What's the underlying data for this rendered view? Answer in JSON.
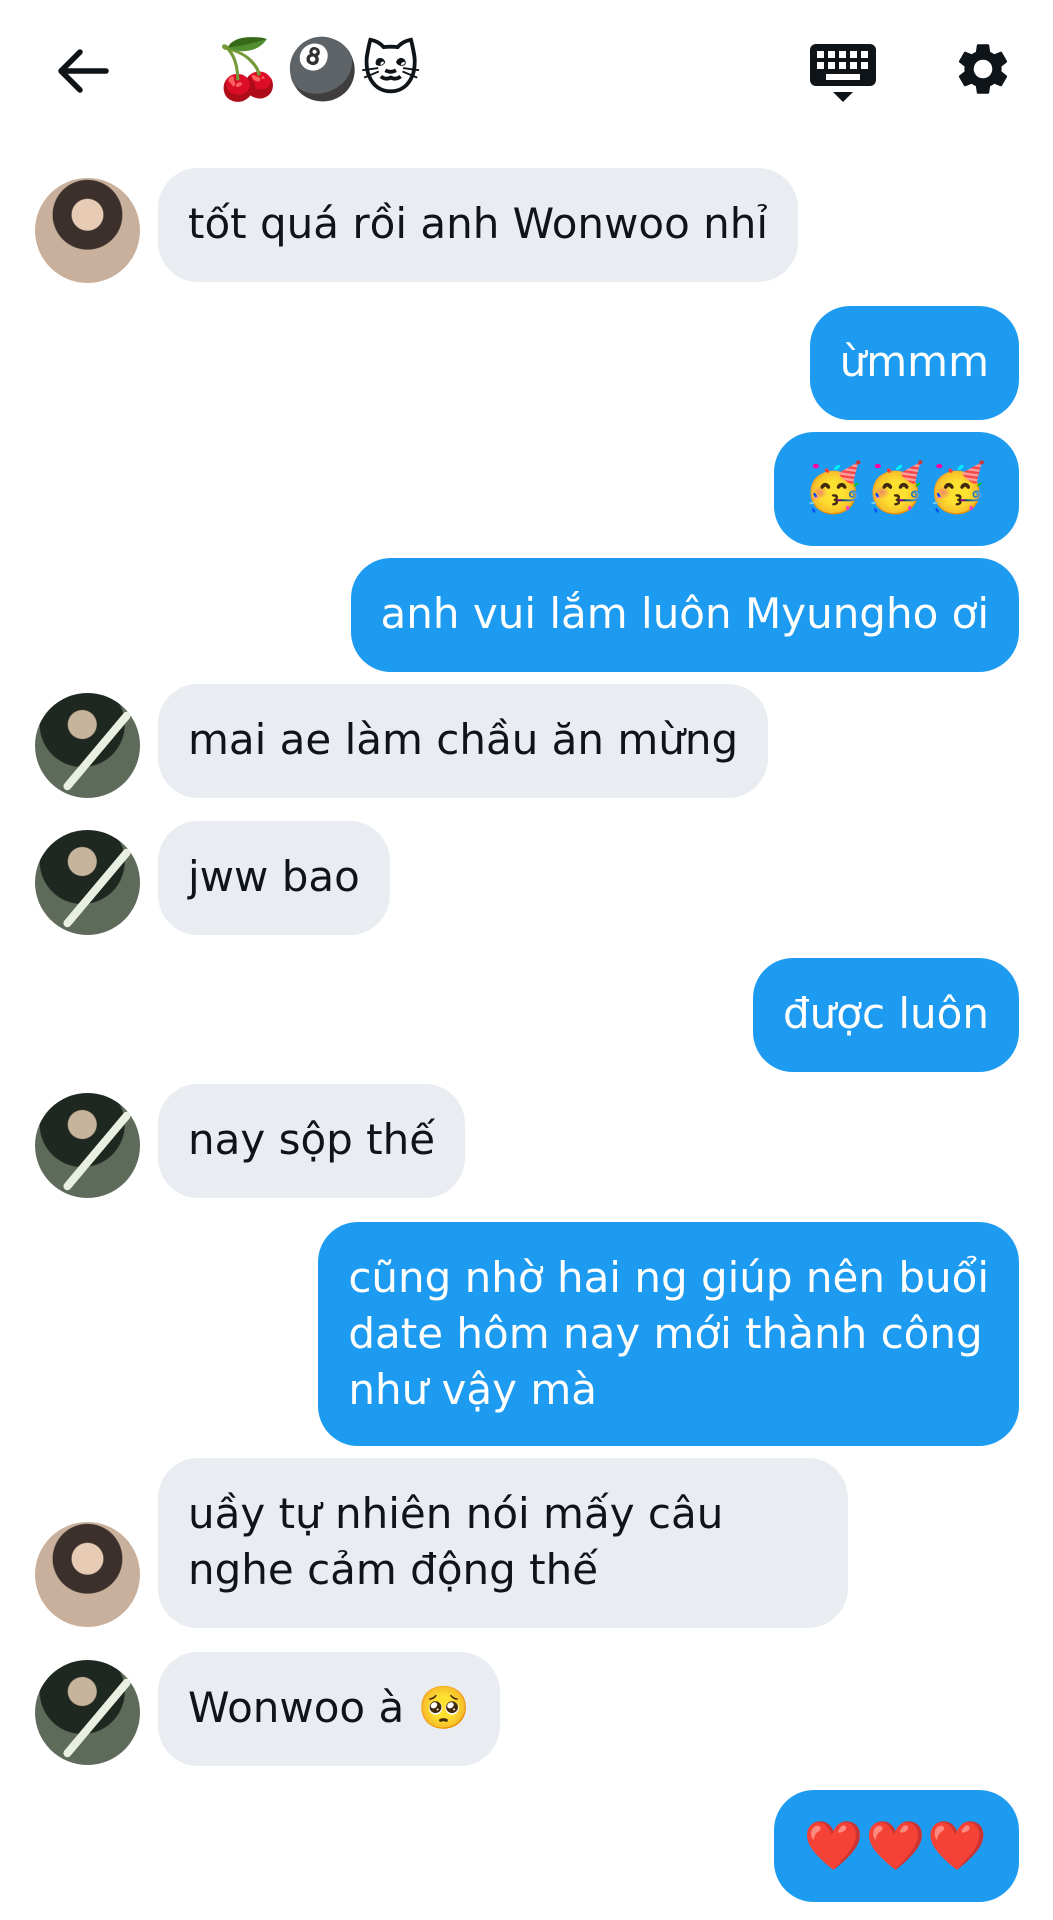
{
  "header": {
    "title": "🍒🎱🐱",
    "back_icon": "arrow-left-icon",
    "keyboard_icon": "keyboard-icon",
    "settings_icon": "gear-icon"
  },
  "colors": {
    "outgoing_bubble": "#1d9bf0",
    "incoming_bubble": "#e9edf1",
    "text": "#0f1419"
  },
  "messages": [
    {
      "side": "in",
      "avatar": "a",
      "text": "tốt quá rồi anh Wonwoo nhỉ"
    },
    {
      "side": "out",
      "text": "ừmmm"
    },
    {
      "side": "out",
      "text": "🥳🥳🥳"
    },
    {
      "side": "out",
      "text": "anh vui lắm luôn Myungho ơi"
    },
    {
      "side": "in",
      "avatar": "b",
      "text": "mai ae làm chầu ăn mừng"
    },
    {
      "side": "in",
      "avatar": "b",
      "text": "jww bao"
    },
    {
      "side": "out",
      "text": "được luôn"
    },
    {
      "side": "in",
      "avatar": "b",
      "text": "nay sộp thế"
    },
    {
      "side": "out",
      "text": "cũng nhờ hai ng giúp nên buổi\ndate hôm nay mới thành công\nnhư vậy mà"
    },
    {
      "side": "in",
      "avatar": "a",
      "text": "uầy tự nhiên nói mấy câu\nnghe cảm động thế"
    },
    {
      "side": "in",
      "avatar": "b",
      "text": "Wonwoo à 🥺"
    },
    {
      "side": "out",
      "text": "❤️❤️❤️"
    }
  ]
}
